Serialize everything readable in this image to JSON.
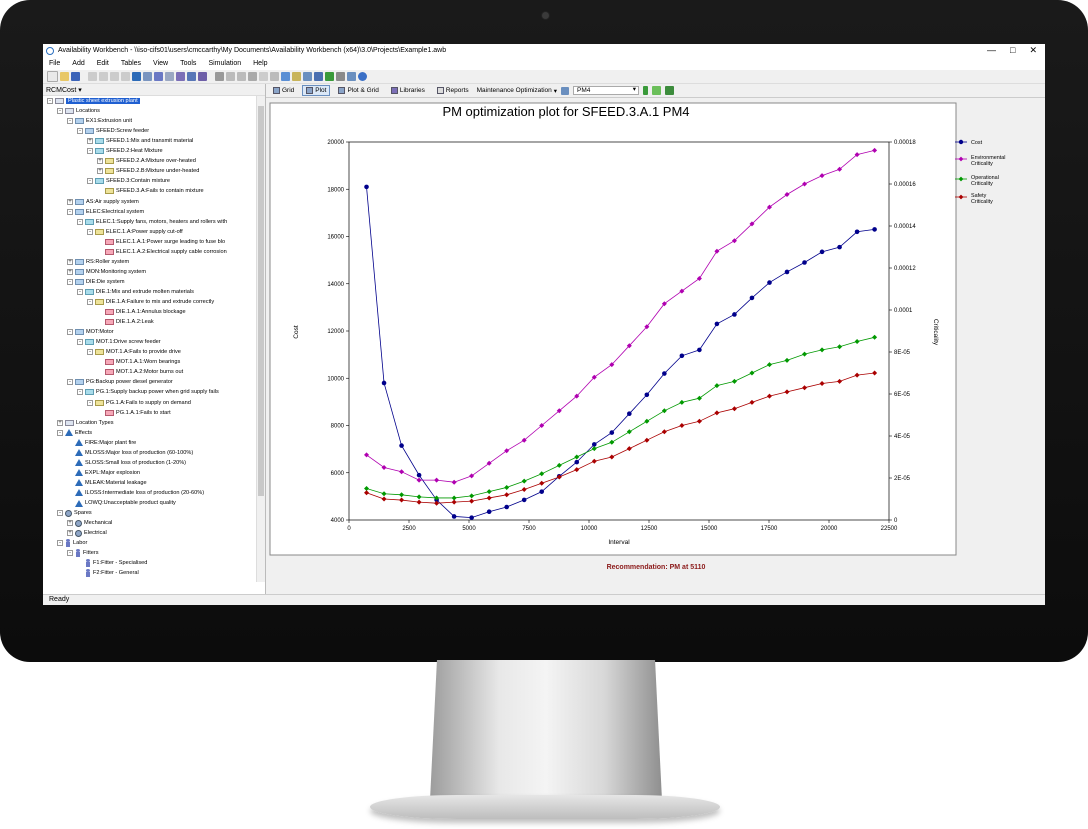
{
  "window": {
    "title": "Availability Workbench - \\\\iso-cifs01\\users\\cmccarthy\\My Documents\\Availability Workbench (x64)\\3.0\\Projects\\Example1.awb",
    "controls": [
      "—",
      "□",
      "✕"
    ]
  },
  "menu": [
    "File",
    "Add",
    "Edit",
    "Tables",
    "View",
    "Tools",
    "Simulation",
    "Help"
  ],
  "left_panel": {
    "dropdown": "RCMCost",
    "tree": [
      {
        "label": "Plastic sheet extrusion plant",
        "level": 0,
        "icon": "plain",
        "expander": "-",
        "selected": true
      },
      {
        "label": "Locations",
        "level": 1,
        "icon": "plain",
        "expander": "-"
      },
      {
        "label": "EX1:Extrusion unit",
        "level": 2,
        "icon": "blue",
        "expander": "-"
      },
      {
        "label": "SFEED:Screw feeder",
        "level": 3,
        "icon": "blue",
        "expander": "-"
      },
      {
        "label": "SFEED.1:Mix and transmit material",
        "level": 4,
        "icon": "cyan",
        "expander": "+"
      },
      {
        "label": "SFEED.2:Heat Mixture",
        "level": 4,
        "icon": "cyan",
        "expander": "-"
      },
      {
        "label": "SFEED.2.A:Mixture over-heated",
        "level": 5,
        "icon": "yellow",
        "expander": "+"
      },
      {
        "label": "SFEED.2.B:Mixture under-heated",
        "level": 5,
        "icon": "yellow",
        "expander": "+"
      },
      {
        "label": "SFEED.3:Contain mixture",
        "level": 4,
        "icon": "cyan",
        "expander": "-"
      },
      {
        "label": "SFEED.3.A:Fails to contain mixture",
        "level": 5,
        "icon": "yellow",
        "expander": ""
      },
      {
        "label": "AS:Air supply system",
        "level": 2,
        "icon": "blue",
        "expander": "+"
      },
      {
        "label": "ELEC:Electrical system",
        "level": 2,
        "icon": "blue",
        "expander": "-"
      },
      {
        "label": "ELEC.1:Supply fans, motors, heaters and rollers with",
        "level": 3,
        "icon": "cyan",
        "expander": "-"
      },
      {
        "label": "ELEC.1.A:Power supply cut-off",
        "level": 4,
        "icon": "yellow",
        "expander": "-"
      },
      {
        "label": "ELEC.1.A.1:Power surge leading to fuse blo",
        "level": 5,
        "icon": "pink",
        "expander": ""
      },
      {
        "label": "ELEC.1.A.2:Electrical supply cable corrosion",
        "level": 5,
        "icon": "pink",
        "expander": ""
      },
      {
        "label": "RS:Roller system",
        "level": 2,
        "icon": "blue",
        "expander": "+"
      },
      {
        "label": "MON:Monitoring system",
        "level": 2,
        "icon": "blue",
        "expander": "+"
      },
      {
        "label": "DIE:Die system",
        "level": 2,
        "icon": "blue",
        "expander": "-"
      },
      {
        "label": "DIE.1:Mix and extrude molten materials",
        "level": 3,
        "icon": "cyan",
        "expander": "-"
      },
      {
        "label": "DIE.1.A:Failure to mix and extrude correctly",
        "level": 4,
        "icon": "yellow",
        "expander": "-"
      },
      {
        "label": "DIE.1.A.1:Annulus blockage",
        "level": 5,
        "icon": "pink",
        "expander": ""
      },
      {
        "label": "DIE.1.A.2:Leak",
        "level": 5,
        "icon": "pink",
        "expander": ""
      },
      {
        "label": "MOT:Motor",
        "level": 2,
        "icon": "blue",
        "expander": "-"
      },
      {
        "label": "MOT.1:Drive screw feeder",
        "level": 3,
        "icon": "cyan",
        "expander": "-"
      },
      {
        "label": "MOT.1.A:Fails to provide drive",
        "level": 4,
        "icon": "yellow",
        "expander": "-"
      },
      {
        "label": "MOT.1.A.1:Worn bearings",
        "level": 5,
        "icon": "pink",
        "expander": ""
      },
      {
        "label": "MOT.1.A.2:Motor burns out",
        "level": 5,
        "icon": "pink",
        "expander": ""
      },
      {
        "label": "PG:Backup power diesel generator",
        "level": 2,
        "icon": "blue",
        "expander": "-"
      },
      {
        "label": "PG.1:Supply backup power when grid supply fails",
        "level": 3,
        "icon": "cyan",
        "expander": "-"
      },
      {
        "label": "PG.1.A:Fails to supply on demand",
        "level": 4,
        "icon": "yellow",
        "expander": "-"
      },
      {
        "label": "PG.1.A.1:Fails to start",
        "level": 5,
        "icon": "pink",
        "expander": ""
      },
      {
        "label": "Location Types",
        "level": 1,
        "icon": "plain",
        "expander": "+"
      },
      {
        "label": "Effects",
        "level": 1,
        "icon": "tri",
        "expander": "-"
      },
      {
        "label": "FIRE:Major plant fire",
        "level": 2,
        "icon": "tri",
        "expander": ""
      },
      {
        "label": "MLOSS:Major loss of production (60-100%)",
        "level": 2,
        "icon": "tri",
        "expander": ""
      },
      {
        "label": "SLOSS:Small loss of production (1-20%)",
        "level": 2,
        "icon": "tri",
        "expander": ""
      },
      {
        "label": "EXPL:Major explosion",
        "level": 2,
        "icon": "tri",
        "expander": ""
      },
      {
        "label": "MLEAK:Material leakage",
        "level": 2,
        "icon": "tri",
        "expander": ""
      },
      {
        "label": "ILOSS:Intermediate loss of production (20-60%)",
        "level": 2,
        "icon": "tri",
        "expander": ""
      },
      {
        "label": "LOWQ:Unacceptable product quality",
        "level": 2,
        "icon": "tri",
        "expander": ""
      },
      {
        "label": "Spares",
        "level": 1,
        "icon": "circ",
        "expander": "-"
      },
      {
        "label": "Mechanical",
        "level": 2,
        "icon": "circ",
        "expander": "+"
      },
      {
        "label": "Electrical",
        "level": 2,
        "icon": "circ",
        "expander": "+"
      },
      {
        "label": "Labor",
        "level": 1,
        "icon": "person",
        "expander": "-"
      },
      {
        "label": "Fitters",
        "level": 2,
        "icon": "person",
        "expander": "-"
      },
      {
        "label": "F1:Fitter - Specialised",
        "level": 3,
        "icon": "person",
        "expander": ""
      },
      {
        "label": "F2:Fitter - General",
        "level": 3,
        "icon": "person",
        "expander": ""
      }
    ]
  },
  "view_tabs": [
    "Grid",
    "Plot",
    "Plot & Grid",
    "Libraries",
    "Reports"
  ],
  "active_tab": "Plot",
  "optimization_mode": "Maintenance Optimization",
  "selected_task": "PM4",
  "status": "Ready",
  "chart_data": {
    "type": "line",
    "title": "PM optimization plot for SFEED.3.A.1 PM4",
    "xlabel": "Interval",
    "ylabel": "Cost",
    "y2label": "Criticality",
    "xlim": [
      0,
      22500
    ],
    "ylim": [
      4000,
      20000
    ],
    "y2lim": [
      0,
      0.00018
    ],
    "x_ticks": [
      "0",
      "2500",
      "5000",
      "7500",
      "10000",
      "12500",
      "15000",
      "17500",
      "20000",
      "22500"
    ],
    "y_ticks": [
      "4000",
      "6000",
      "8000",
      "10000",
      "12000",
      "14000",
      "16000",
      "18000",
      "20000"
    ],
    "y2_ticks": [
      "0",
      "2E-05",
      "4E-05",
      "6E-05",
      "8E-05",
      "0.0001",
      "0.00012",
      "0.00014",
      "0.00016",
      "0.00018"
    ],
    "legend_position": "right",
    "recommendation": "Recommendation: PM at 5110",
    "x": [
      730,
      1460,
      2190,
      2920,
      3650,
      4380,
      5110,
      5840,
      6570,
      7300,
      8030,
      8760,
      9490,
      10220,
      10950,
      11680,
      12410,
      13140,
      13870,
      14600,
      15330,
      16060,
      16790,
      17520,
      18250,
      18980,
      19710,
      20440,
      21170,
      21900
    ],
    "series": [
      {
        "name": "Cost",
        "color": "#00008b",
        "marker": "circle",
        "axis": "left",
        "values": [
          18100,
          9800,
          7150,
          5900,
          4850,
          4150,
          4100,
          4350,
          4550,
          4850,
          5200,
          5850,
          6450,
          7200,
          7700,
          8500,
          9300,
          10200,
          10950,
          11200,
          12300,
          12700,
          13400,
          14050,
          14500,
          14900,
          15350,
          15550,
          16200,
          16300
        ]
      },
      {
        "name": "Environmental Criticality",
        "color": "#b000b0",
        "marker": "diamond",
        "axis": "right",
        "values": [
          3.1e-05,
          2.5e-05,
          2.3e-05,
          1.9e-05,
          1.9e-05,
          1.8e-05,
          2.1e-05,
          2.7e-05,
          3.3e-05,
          3.8e-05,
          4.5e-05,
          5.2e-05,
          5.9e-05,
          6.8e-05,
          7.4e-05,
          8.3e-05,
          9.2e-05,
          0.000103,
          0.000109,
          0.000115,
          0.000128,
          0.000133,
          0.000141,
          0.000149,
          0.000155,
          0.00016,
          0.000164,
          0.000167,
          0.000174,
          0.000176
        ]
      },
      {
        "name": "Operational Criticality",
        "color": "#009900",
        "marker": "diamond",
        "axis": "right",
        "values": [
          1.5e-05,
          1.25e-05,
          1.2e-05,
          1.1e-05,
          1.05e-05,
          1.05e-05,
          1.15e-05,
          1.35e-05,
          1.55e-05,
          1.85e-05,
          2.2e-05,
          2.6e-05,
          3e-05,
          3.4e-05,
          3.7e-05,
          4.2e-05,
          4.7e-05,
          5.2e-05,
          5.6e-05,
          5.8e-05,
          6.4e-05,
          6.6e-05,
          7e-05,
          7.4e-05,
          7.6e-05,
          7.9e-05,
          8.1e-05,
          8.25e-05,
          8.5e-05,
          8.7e-05
        ]
      },
      {
        "name": "Safety Criticality",
        "color": "#aa0000",
        "marker": "diamond",
        "axis": "right",
        "values": [
          1.3e-05,
          1e-05,
          9.5e-06,
          8.5e-06,
          8e-06,
          8.5e-06,
          9e-06,
          1.05e-05,
          1.2e-05,
          1.45e-05,
          1.75e-05,
          2.05e-05,
          2.4e-05,
          2.8e-05,
          3e-05,
          3.4e-05,
          3.8e-05,
          4.2e-05,
          4.5e-05,
          4.7e-05,
          5.1e-05,
          5.3e-05,
          5.6e-05,
          5.9e-05,
          6.1e-05,
          6.3e-05,
          6.5e-05,
          6.6e-05,
          6.9e-05,
          7e-05
        ]
      }
    ]
  }
}
